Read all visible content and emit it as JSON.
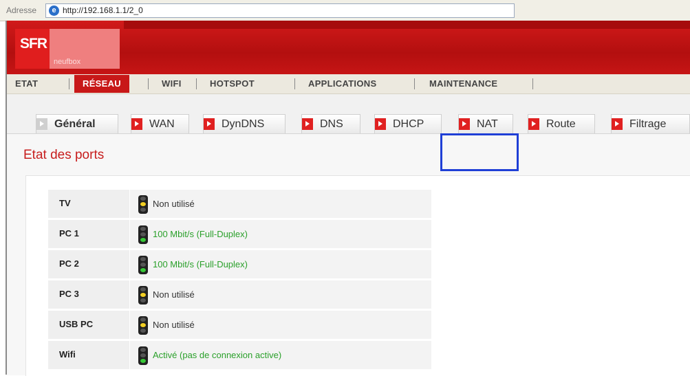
{
  "browser": {
    "address_label": "Adresse",
    "url": "http://192.168.1.1/2_0"
  },
  "header": {
    "logo_text": "SFR",
    "logo_sub": "neufbox"
  },
  "main_nav": [
    "ETAT",
    "RÉSEAU",
    "WIFI",
    "HOTSPOT",
    "APPLICATIONS",
    "MAINTENANCE"
  ],
  "main_nav_active": "RÉSEAU",
  "sub_tabs": [
    "Général",
    "WAN",
    "DynDNS",
    "DNS",
    "DHCP",
    "NAT",
    "Route",
    "Filtrage"
  ],
  "sub_tab_active": "Général",
  "highlighted_tab": "NAT",
  "section_title": "Etat des ports",
  "ports": [
    {
      "name": "TV",
      "status": "Non utilisé",
      "light": "yellow"
    },
    {
      "name": "PC 1",
      "status": "100 Mbit/s (Full-Duplex)",
      "light": "green"
    },
    {
      "name": "PC 2",
      "status": "100 Mbit/s (Full-Duplex)",
      "light": "green"
    },
    {
      "name": "PC 3",
      "status": "Non utilisé",
      "light": "yellow"
    },
    {
      "name": "USB PC",
      "status": "Non utilisé",
      "light": "yellow"
    },
    {
      "name": "Wifi",
      "status": "Activé (pas de connexion active)",
      "light": "green"
    }
  ],
  "colors": {
    "brand_red": "#c81818",
    "ok_green": "#2aa02a",
    "highlight_blue": "#1f3fd6"
  }
}
